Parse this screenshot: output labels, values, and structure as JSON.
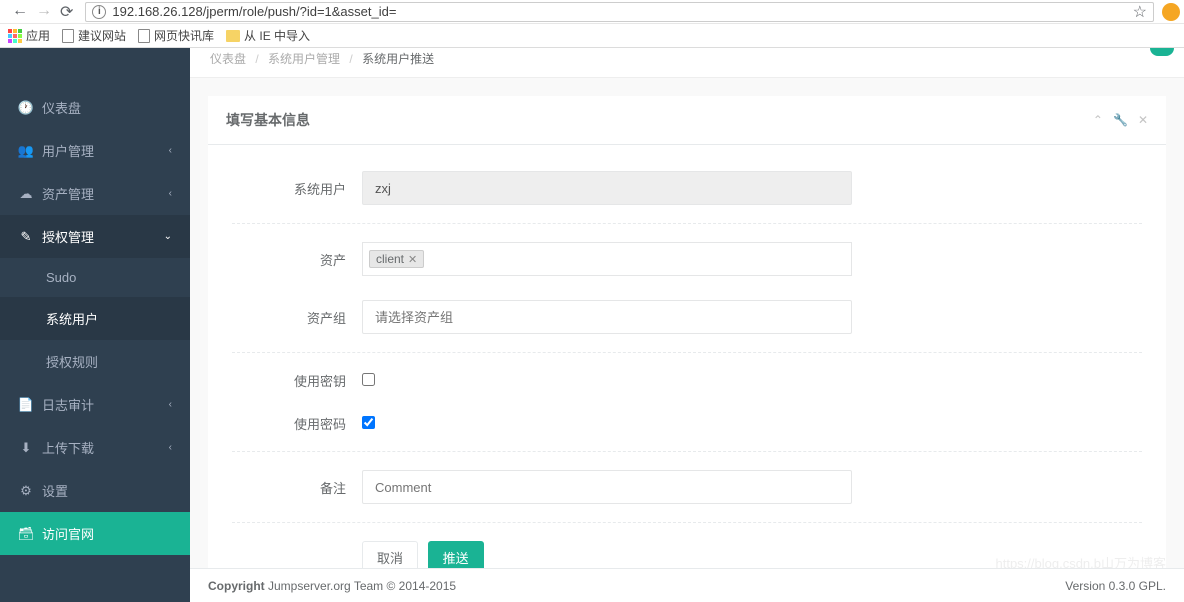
{
  "browser": {
    "url": "192.168.26.128/jperm/role/push/?id=1&asset_id=",
    "bookmarks": {
      "apps": "应用",
      "suggest": "建议网站",
      "quick": "网页快讯库",
      "ie_import": "从 IE 中导入"
    }
  },
  "breadcrumb": {
    "dashboard": "仪表盘",
    "mgmt": "系统用户管理",
    "push": "系统用户推送"
  },
  "sidebar": {
    "dashboard": "仪表盘",
    "user_mgmt": "用户管理",
    "asset_mgmt": "资产管理",
    "perm_mgmt": "授权管理",
    "sudo": "Sudo",
    "sysuser": "系统用户",
    "perm_rule": "授权规则",
    "log_audit": "日志审计",
    "upload_download": "上传下载",
    "settings": "设置",
    "visit_site": "访问官网"
  },
  "panel": {
    "title": "填写基本信息"
  },
  "form": {
    "sys_user_label": "系统用户",
    "sys_user_value": "zxj",
    "asset_label": "资产",
    "asset_tag": "client",
    "asset_group_label": "资产组",
    "asset_group_placeholder": "请选择资产组",
    "use_key_label": "使用密钥",
    "use_password_label": "使用密码",
    "comment_label": "备注",
    "comment_placeholder": "Comment",
    "cancel": "取消",
    "submit": "推送"
  },
  "footer": {
    "copy_bold": "Copyright",
    "copy_rest": " Jumpserver.org Team © 2014-2015",
    "version": "Version 0.3.0 GPL.",
    "watermark": "https://blog.csdn.b山万为博客"
  }
}
